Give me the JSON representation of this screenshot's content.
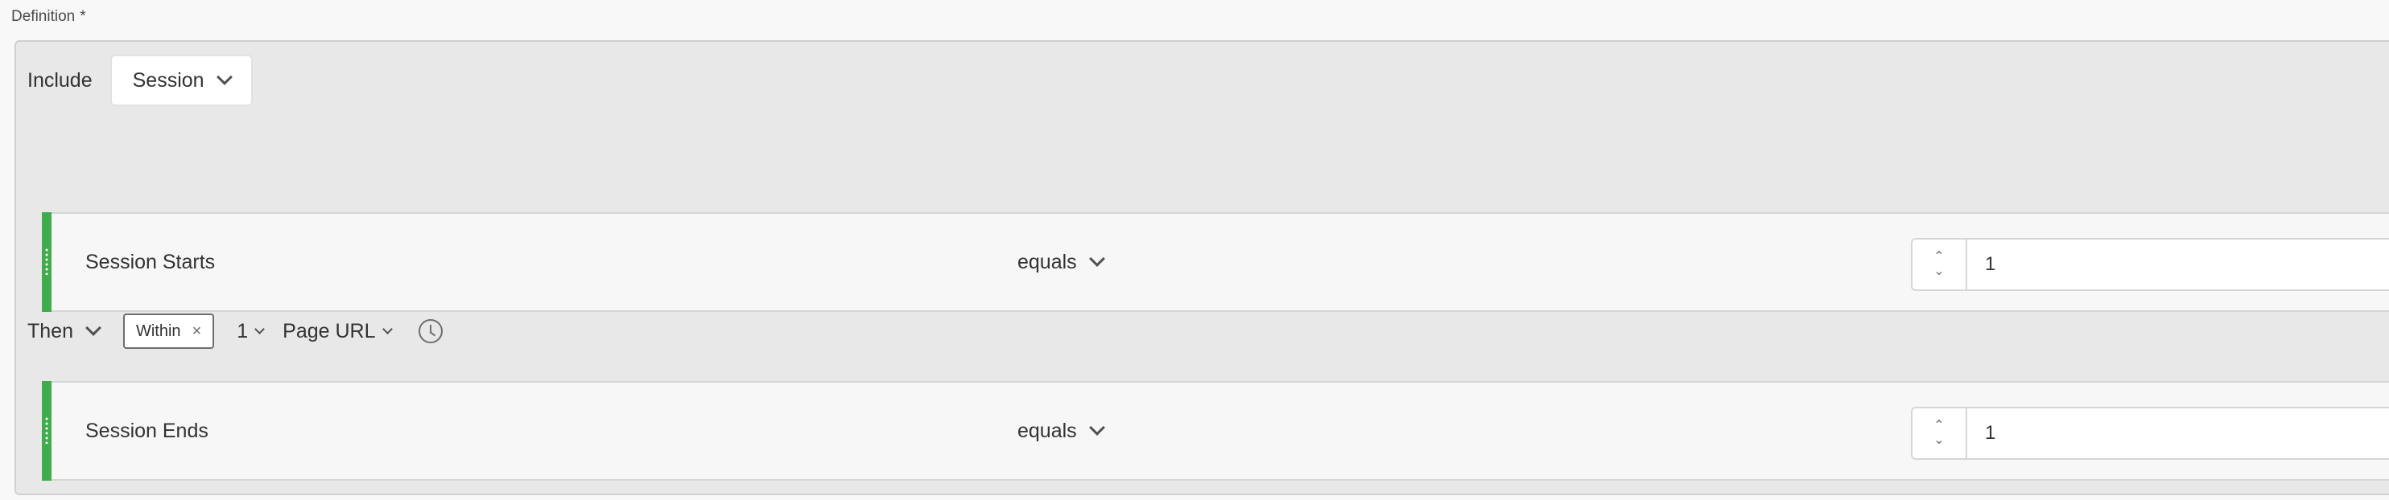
{
  "definition": {
    "label": "Definition",
    "required_mark": "*"
  },
  "include": {
    "label": "Include",
    "selected": "Session"
  },
  "rules": [
    {
      "dimension": "Session Starts",
      "operator": "equals",
      "value": "1"
    },
    {
      "dimension": "Session Ends",
      "operator": "equals",
      "value": "1"
    }
  ],
  "then_row": {
    "label": "Then",
    "tag": "Within",
    "tag_remove": "×",
    "count": "1",
    "unit": "Page URL"
  },
  "stepper": {
    "up": "⌃",
    "down": "⌄"
  },
  "colors": {
    "accent_green": "#3dae4a",
    "panel": "#e8e8e8"
  },
  "icons": {
    "clock": "clock-icon",
    "chevron": "chevron-down-icon",
    "grip": "drag-handle-icon"
  }
}
